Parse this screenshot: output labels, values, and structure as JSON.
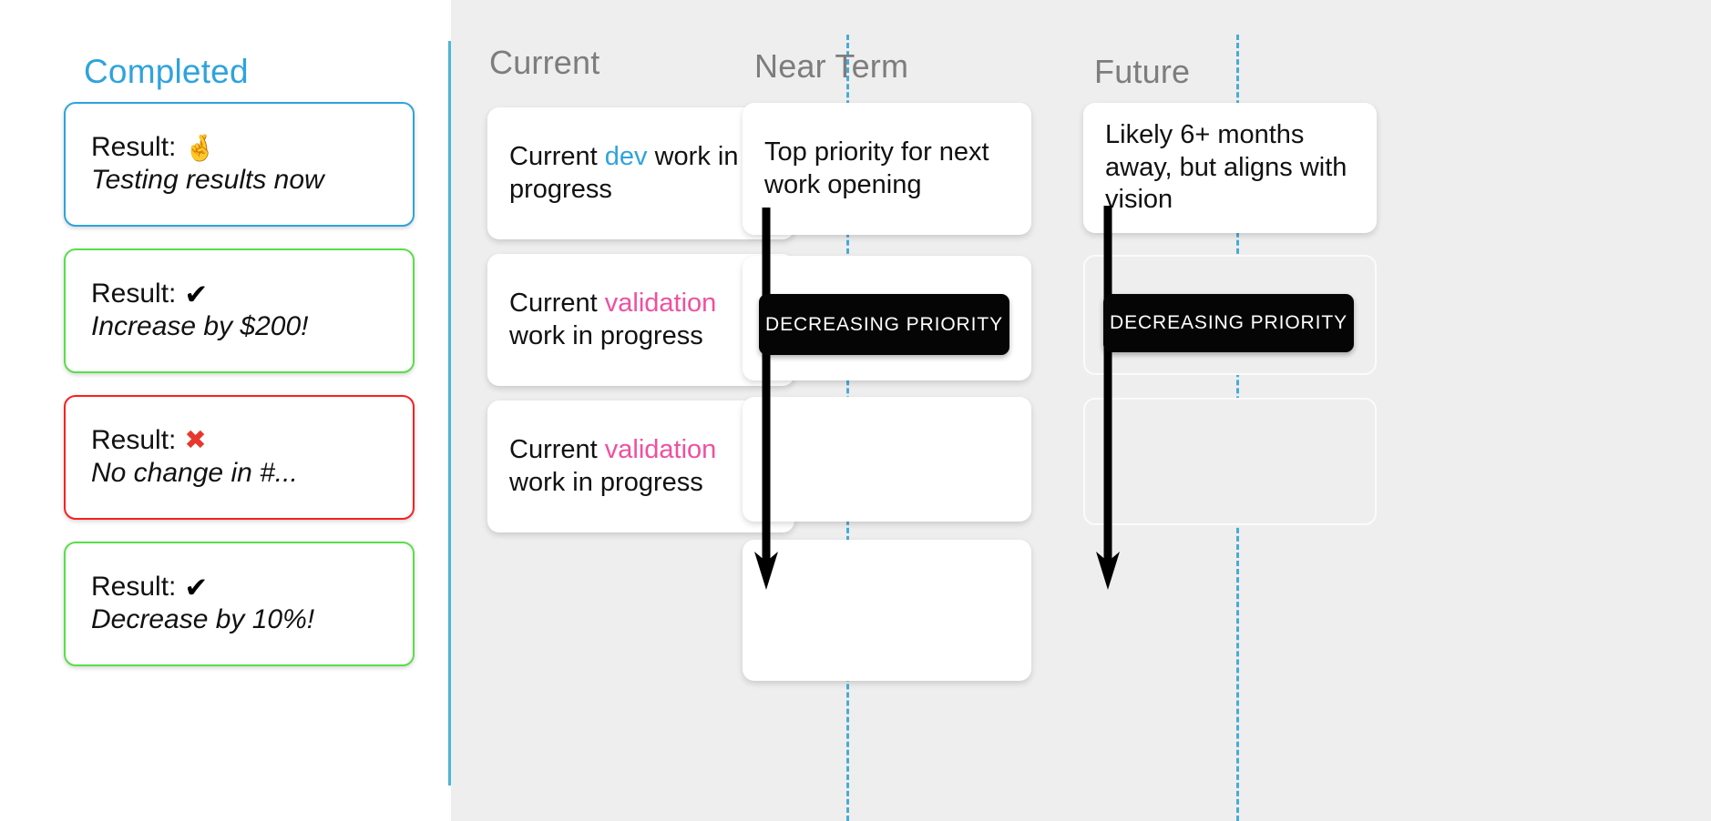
{
  "completed": {
    "title": "Completed",
    "accent_color": "#2fa3dd",
    "cards": [
      {
        "label": "Result:",
        "icon": "crossed-fingers-icon",
        "icon_glyph": "🤞",
        "result": "Testing results now",
        "border_color": "#2fa3dd",
        "status": "in-testing"
      },
      {
        "label": "Result:",
        "icon": "check-mark-icon",
        "icon_glyph": "✔",
        "result": "Increase by $200!",
        "border_color": "#5ade4a",
        "status": "success"
      },
      {
        "label": "Result:",
        "icon": "cross-mark-icon",
        "icon_glyph": "✖",
        "result": "No change in #...",
        "border_color": "#f92020",
        "status": "failure"
      },
      {
        "label": "Result:",
        "icon": "check-mark-icon",
        "icon_glyph": "✔",
        "result": "Decrease by 10%!",
        "border_color": "#5ade4a",
        "status": "success"
      }
    ]
  },
  "roadmap": {
    "divider_color": "#45acd8",
    "badge_label": "DECREASING PRIORITY",
    "columns": [
      {
        "title": "Current",
        "cards": [
          {
            "parts": [
              {
                "text": "Current ",
                "style": "plain"
              },
              {
                "text": "dev",
                "style": "dev"
              },
              {
                "text": " work in progress",
                "style": "plain"
              }
            ],
            "empty": false,
            "ghost": false
          },
          {
            "parts": [
              {
                "text": "Current ",
                "style": "plain"
              },
              {
                "text": "validation",
                "style": "val"
              },
              {
                "text": " work in progress",
                "style": "plain"
              }
            ],
            "empty": false,
            "ghost": false
          },
          {
            "parts": [
              {
                "text": "Current ",
                "style": "plain"
              },
              {
                "text": "validation",
                "style": "val"
              },
              {
                "text": " work in progress",
                "style": "plain"
              }
            ],
            "empty": false,
            "ghost": false
          }
        ]
      },
      {
        "title": "Near Term",
        "cards": [
          {
            "parts": [
              {
                "text": "Top priority for next work opening",
                "style": "plain"
              }
            ],
            "empty": false,
            "ghost": false
          },
          {
            "parts": [],
            "empty": true,
            "ghost": false
          },
          {
            "parts": [],
            "empty": true,
            "ghost": false
          },
          {
            "parts": [],
            "empty": true,
            "ghost": false
          }
        ]
      },
      {
        "title": "Future",
        "cards": [
          {
            "parts": [
              {
                "text": "Likely 6+ months away, but aligns with vision",
                "style": "plain"
              }
            ],
            "empty": false,
            "ghost": false
          },
          {
            "parts": [],
            "empty": true,
            "ghost": true
          },
          {
            "parts": [],
            "empty": true,
            "ghost": true
          }
        ]
      }
    ]
  }
}
